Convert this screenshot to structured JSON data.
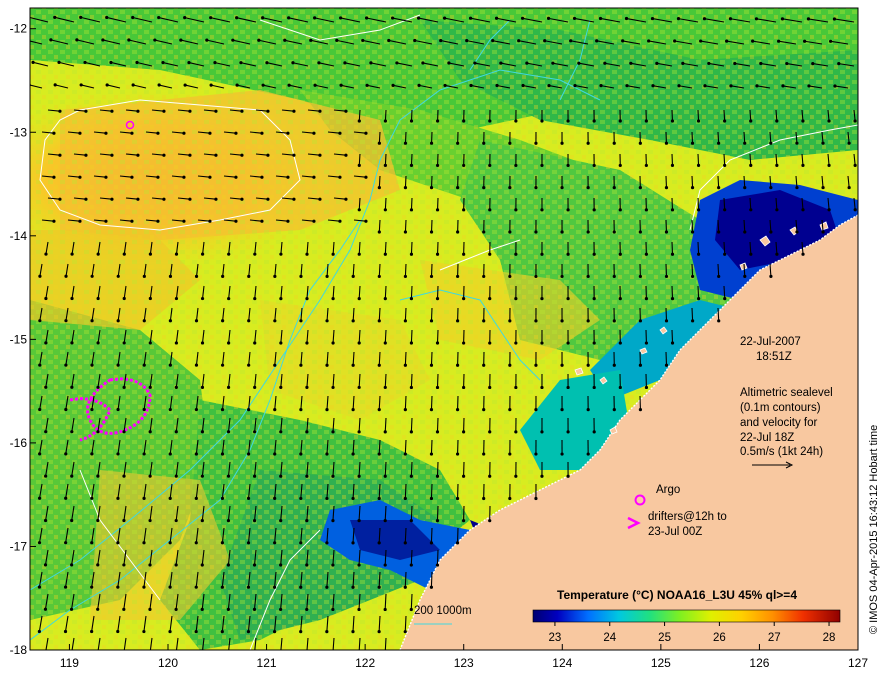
{
  "map": {
    "lon_range": [
      118.6,
      127.0
    ],
    "lat_range": [
      -18.0,
      -11.8
    ],
    "x_ticks": [
      "119",
      "120",
      "121",
      "122",
      "123",
      "124",
      "125",
      "126",
      "127"
    ],
    "y_ticks": [
      "-12",
      "-13",
      "-14",
      "-15",
      "-16",
      "-17",
      "-18"
    ],
    "colors": {
      "land": "#f8c8a0",
      "coast_outline": "#ffffff",
      "sst_contour": "#ffffff",
      "bathy_contour": "#40d8e0",
      "drifter": "#ff00ff",
      "argo": "#ff00ff",
      "vector": "#000000"
    }
  },
  "annotations": {
    "date": "22-Jul-2007",
    "time": "18:51Z",
    "legend_line1": "Altimetric sealevel",
    "legend_line2": "(0.1m contours)",
    "legend_line3": "and velocity for",
    "legend_line4": "22-Jul 18Z",
    "legend_line5": "0.5m/s (1kt 24h)",
    "argo_label": "Argo",
    "drifters_line1": "drifters@12h to",
    "drifters_line2": "23-Jul 00Z",
    "bathy_label": "200  1000m"
  },
  "colorbar": {
    "title": "Temperature (°C) NOAA16_L3U 45% ql>=4",
    "ticks": [
      "23",
      "24",
      "25",
      "26",
      "27",
      "28"
    ],
    "range": [
      22.6,
      28.2
    ],
    "colors": [
      "#000080",
      "#0000ff",
      "#0080ff",
      "#00c0c0",
      "#00ff80",
      "#80ff00",
      "#ffff00",
      "#ffc000",
      "#ff8000",
      "#ff0000",
      "#800000"
    ]
  },
  "credit": "© IMOS 04-Apr-2015 16:43:12 Hobart time"
}
